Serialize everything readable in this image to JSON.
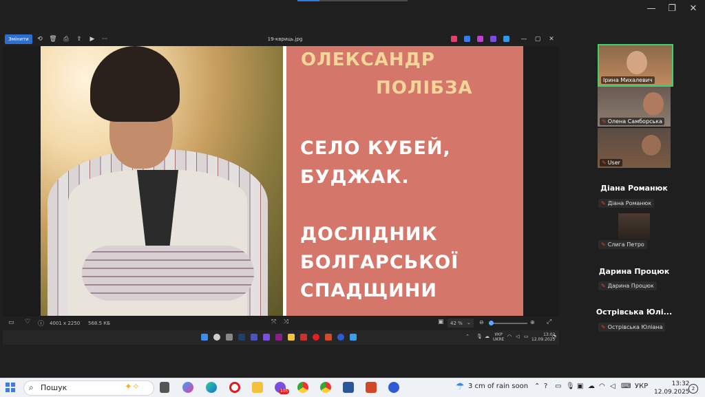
{
  "window_controls": {
    "minimize": "—",
    "restore": "❐",
    "close": "✕"
  },
  "viewer": {
    "file_name": "19-квриць.jpg",
    "edit_label": "Змінити",
    "toolbar_menu": "···",
    "min": "—",
    "max": "▢",
    "close": "✕",
    "info_dimensions": "4001 x 2250",
    "info_size": "568.5 КБ",
    "zoom": "42 %",
    "zoom_fraction": 0.05
  },
  "slide": {
    "name_line1": "ОЛЕКСАНДР",
    "name_line2": "ПОЛІБЗА",
    "lines": [
      "СЕЛО КУБЕЙ,",
      "БУДЖАК.",
      "ДОСЛІДНИК",
      "БОЛГАРСЬКОЇ",
      "СПАДЩИНИ"
    ]
  },
  "shared_taskbar": {
    "lang1": "УКР",
    "lang2": "UKRE",
    "time": "13:02",
    "date": "12.09.2025"
  },
  "participants": {
    "tiles": [
      {
        "name": "Ірина Михалевич"
      },
      {
        "name": "Олена Самборська"
      },
      {
        "name": "User"
      }
    ],
    "headers": [
      "Діана Романюк",
      "Дарина Процюк",
      "Острівська Юлі..."
    ],
    "chips": [
      "Діана Романюк",
      "Слига Петро",
      "Дарина Процюк",
      "Острівська Юліана"
    ]
  },
  "taskbar": {
    "search_label": "Пошук",
    "weather": "3 cm of rain soon",
    "lang": "УКР",
    "time": "13:32",
    "date": "12.09.2025",
    "notif_count": "2",
    "badge_viber": "105"
  },
  "colors": {
    "slide_bg": "#d4766a",
    "name_color": "#f3d59a",
    "active_border": "#3bd16f",
    "edit_blue": "#2c6fd0"
  }
}
